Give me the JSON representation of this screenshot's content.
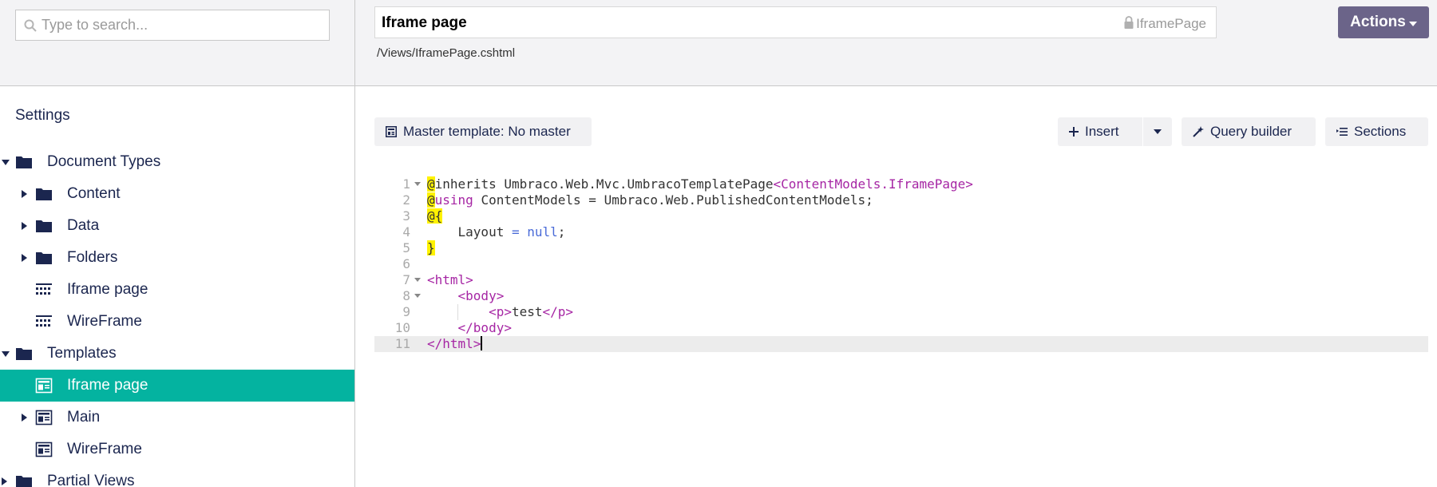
{
  "search": {
    "placeholder": "Type to search..."
  },
  "sidebar": {
    "title": "Settings",
    "tree": [
      {
        "label": "Document Types",
        "level": 0,
        "caret": "down",
        "icon": "folder-icon"
      },
      {
        "label": "Content",
        "level": 1,
        "caret": "right",
        "icon": "folder-icon"
      },
      {
        "label": "Data",
        "level": 1,
        "caret": "right",
        "icon": "folder-icon"
      },
      {
        "label": "Folders",
        "level": 1,
        "caret": "right",
        "icon": "folder-icon"
      },
      {
        "label": "Iframe page",
        "level": 1,
        "caret": "none",
        "icon": "document-type-icon"
      },
      {
        "label": "WireFrame",
        "level": 1,
        "caret": "none",
        "icon": "document-type-icon"
      },
      {
        "label": "Templates",
        "level": 0,
        "caret": "down",
        "icon": "folder-icon"
      },
      {
        "label": "Iframe page",
        "level": 1,
        "caret": "none",
        "icon": "template-icon",
        "selected": true
      },
      {
        "label": "Main",
        "level": 1,
        "caret": "right",
        "icon": "template-icon"
      },
      {
        "label": "WireFrame",
        "level": 1,
        "caret": "none",
        "icon": "template-icon"
      },
      {
        "label": "Partial Views",
        "level": 0,
        "caret": "right",
        "icon": "folder-icon"
      }
    ]
  },
  "header": {
    "name": "Iframe page",
    "alias": "IframePage",
    "path": "/Views/IframePage.cshtml",
    "actions_label": "Actions"
  },
  "toolbar": {
    "master_template_label": "Master template: No master",
    "insert_label": "Insert",
    "query_builder_label": "Query builder",
    "sections_label": "Sections"
  },
  "editor": {
    "active_line": 11,
    "lines": [
      "@inherits Umbraco.Web.Mvc.UmbracoTemplatePage<ContentModels.IframePage>",
      "@using ContentModels = Umbraco.Web.PublishedContentModels;",
      "@{",
      "    Layout = null;",
      "}",
      "",
      "<html>",
      "    <body>",
      "        <p>test</p>",
      "    </body>",
      "</html>"
    ]
  },
  "colors": {
    "selected_bg": "#04b3a0",
    "actions_bg": "#6b6489",
    "header_bg": "#f3f3f5"
  }
}
